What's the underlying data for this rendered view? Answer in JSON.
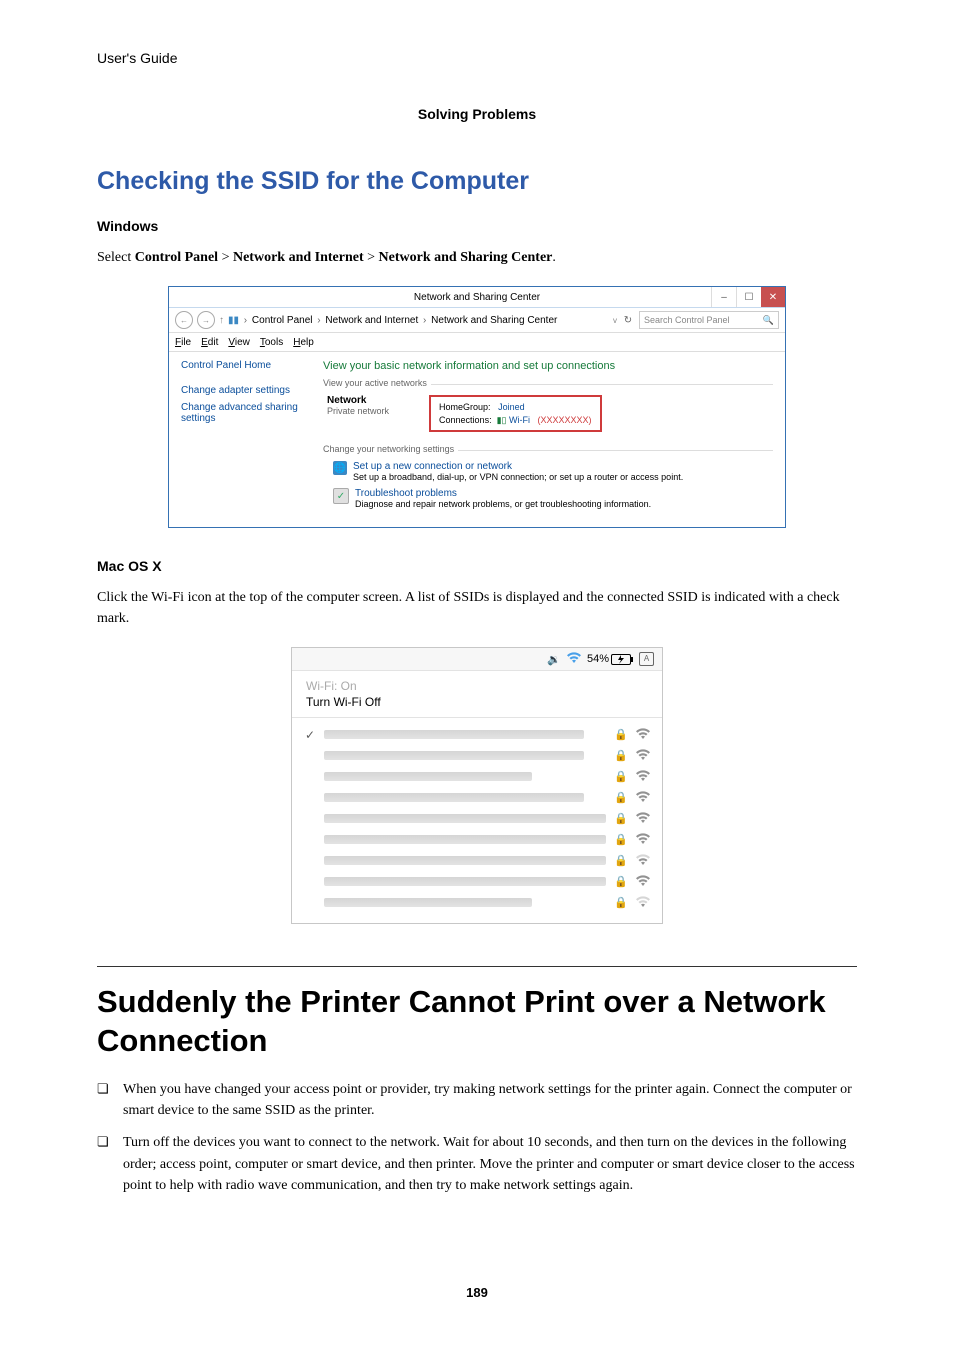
{
  "header": {
    "guide": "User's Guide",
    "section": "Solving Problems"
  },
  "heading_ssid": "Checking the SSID for the Computer",
  "windows": {
    "label": "Windows",
    "instruction_prefix": "Select ",
    "path1": "Control Panel",
    "gt1": " > ",
    "path2": "Network and Internet",
    "gt2": " > ",
    "path3": "Network and Sharing Center",
    "period": "."
  },
  "winshot": {
    "title": "Network and Sharing Center",
    "breadcrumb": {
      "b1": "Control Panel",
      "b2": "Network and Internet",
      "b3": "Network and Sharing Center"
    },
    "search_placeholder": "Search Control Panel",
    "menu": {
      "file": "File",
      "edit": "Edit",
      "view": "View",
      "tools": "Tools",
      "help": "Help"
    },
    "sidebar": {
      "home": "Control Panel Home",
      "link1": "Change adapter settings",
      "link2": "Change advanced sharing settings"
    },
    "content": {
      "title": "View your basic network information and set up connections",
      "fieldset1": "View your active networks",
      "net_name": "Network",
      "net_type": "Private network",
      "homegroup_label": "HomeGroup:",
      "homegroup_value": "Joined",
      "conn_label": "Connections:",
      "wifi_label": "Wi-Fi",
      "ssid": "(XXXXXXXX)",
      "fieldset2": "Change your networking settings",
      "action1_title": "Set up a new connection or network",
      "action1_desc": "Set up a broadband, dial-up, or VPN connection; or set up a router or access point.",
      "action2_title": "Troubleshoot problems",
      "action2_desc": "Diagnose and repair network problems, or get troubleshooting information."
    }
  },
  "mac": {
    "label": "Mac OS X",
    "instruction": "Click the Wi-Fi icon at the top of the computer screen. A list of SSIDs is displayed and the connected SSID is indicated with a check mark."
  },
  "macshot": {
    "battery": "54%",
    "status": "Wi-Fi: On",
    "toggle": "Turn Wi-Fi Off"
  },
  "section2": {
    "title": "Suddenly the Printer Cannot Print over a Network Connection",
    "bullets": [
      "When you have changed your access point or provider, try making network settings for the printer again. Connect the computer or smart device to the same SSID as the printer.",
      "Turn off the devices you want to connect to the network. Wait for about 10 seconds, and then turn on the devices in the following order; access point, computer or smart device, and then printer. Move the printer and computer or smart device closer to the access point to help with radio wave communication, and then try to make network settings again."
    ]
  },
  "page_number": "189"
}
